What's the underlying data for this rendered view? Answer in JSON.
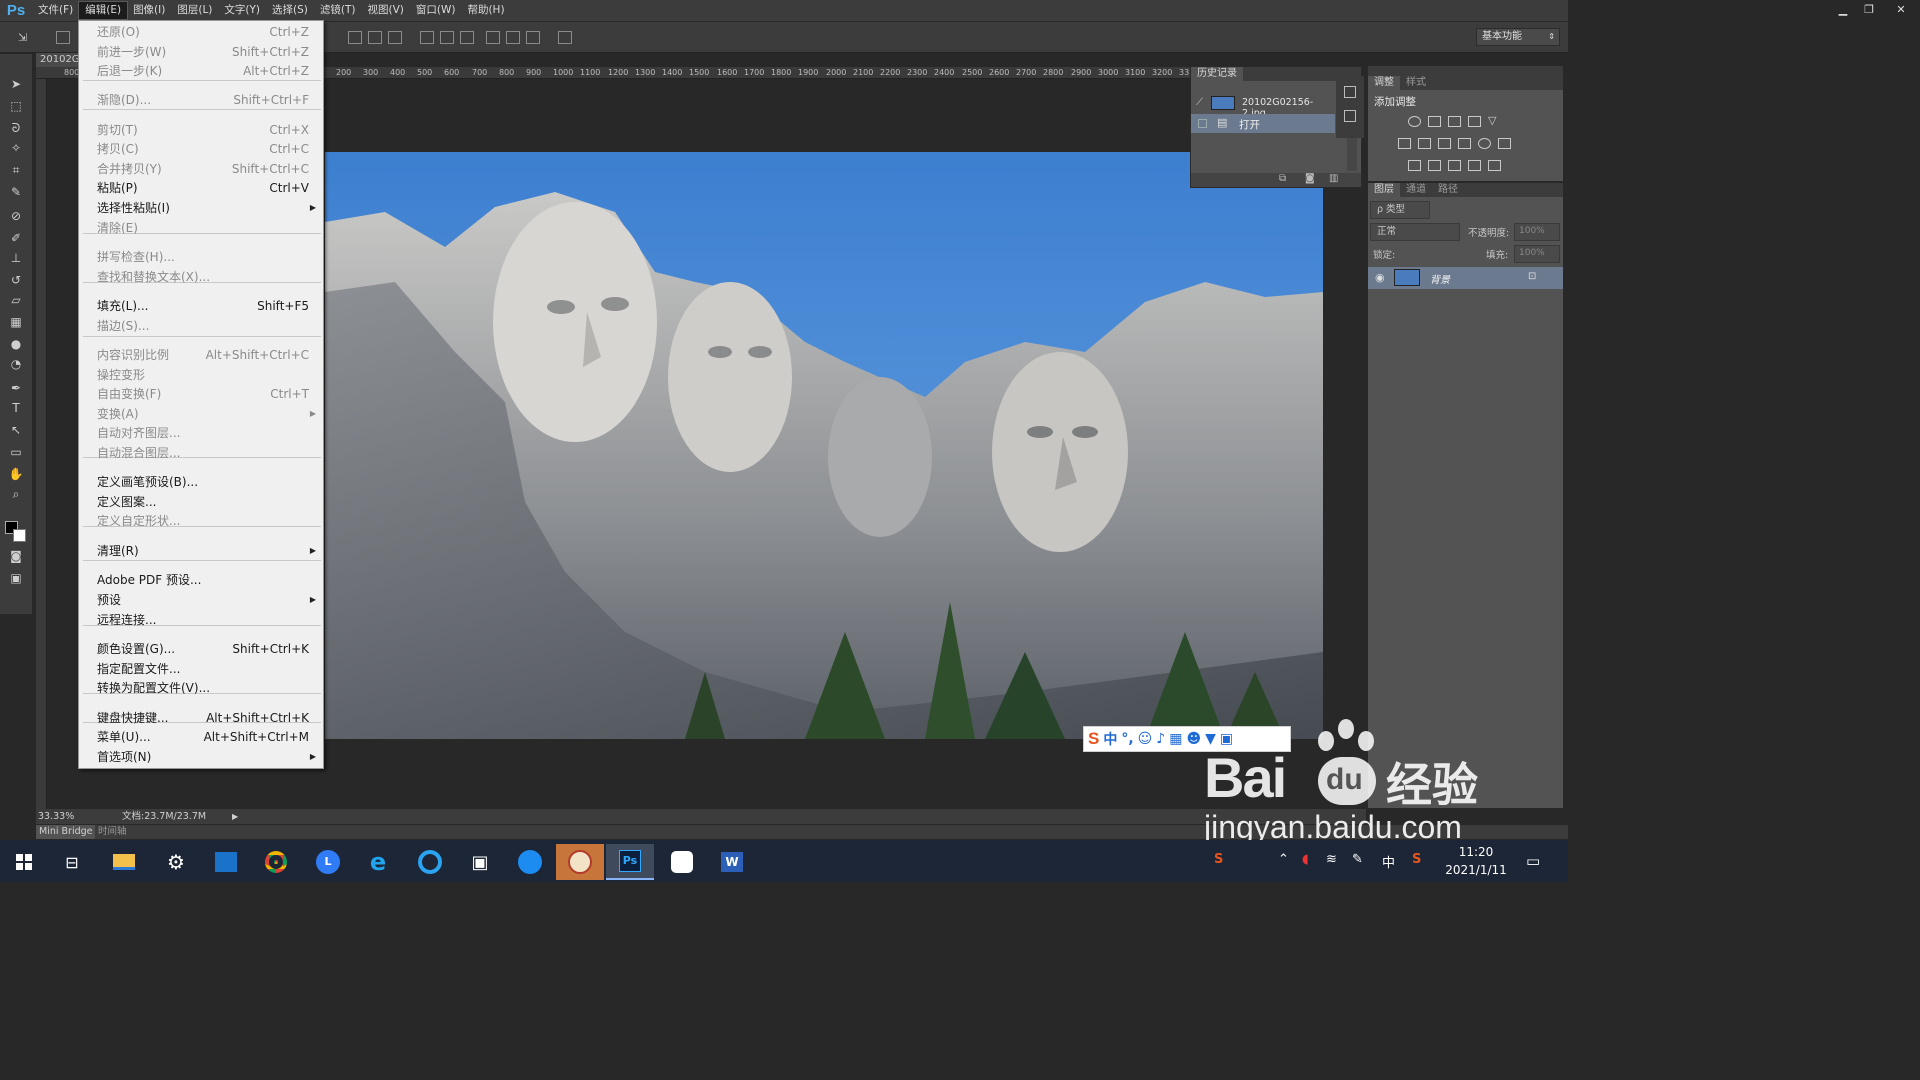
{
  "app": {
    "logo": "Ps"
  },
  "menubar": [
    "文件(F)",
    "编辑(E)",
    "图像(I)",
    "图层(L)",
    "文字(Y)",
    "选择(S)",
    "滤镜(T)",
    "视图(V)",
    "窗口(W)",
    "帮助(H)"
  ],
  "window_controls": {
    "minimize": "▁",
    "restore": "❐",
    "close": "✕"
  },
  "options": {
    "workspace": "基本功能"
  },
  "document": {
    "tab": "20102G",
    "ruler_top": [
      "800",
      "200",
      "300",
      "400",
      "500",
      "600",
      "700",
      "800",
      "900",
      "1000",
      "1100",
      "1200",
      "1300",
      "1400",
      "1500",
      "1600",
      "1700",
      "1800",
      "1900",
      "2000",
      "2100",
      "2200",
      "2300",
      "2400",
      "2500",
      "2600",
      "2700",
      "2800",
      "2900",
      "3000",
      "3100",
      "3200",
      "33"
    ]
  },
  "edit_menu": {
    "items": [
      {
        "label": "还原(O)",
        "shortcut": "Ctrl+Z",
        "disabled": true
      },
      {
        "label": "前进一步(W)",
        "shortcut": "Shift+Ctrl+Z",
        "disabled": true
      },
      {
        "label": "后退一步(K)",
        "shortcut": "Alt+Ctrl+Z",
        "disabled": true
      },
      {
        "label": "渐隐(D)...",
        "shortcut": "Shift+Ctrl+F",
        "disabled": true
      },
      {
        "label": "剪切(T)",
        "shortcut": "Ctrl+X",
        "disabled": true
      },
      {
        "label": "拷贝(C)",
        "shortcut": "Ctrl+C",
        "disabled": true
      },
      {
        "label": "合并拷贝(Y)",
        "shortcut": "Shift+Ctrl+C",
        "disabled": true
      },
      {
        "label": "粘贴(P)",
        "shortcut": "Ctrl+V",
        "disabled": false
      },
      {
        "label": "选择性粘贴(I)",
        "shortcut": "",
        "disabled": false
      },
      {
        "label": "清除(E)",
        "shortcut": "",
        "disabled": true
      },
      {
        "label": "拼写检查(H)...",
        "shortcut": "",
        "disabled": true
      },
      {
        "label": "查找和替换文本(X)...",
        "shortcut": "",
        "disabled": true
      },
      {
        "label": "填充(L)...",
        "shortcut": "Shift+F5",
        "disabled": false
      },
      {
        "label": "描边(S)...",
        "shortcut": "",
        "disabled": true
      },
      {
        "label": "内容识别比例",
        "shortcut": "Alt+Shift+Ctrl+C",
        "disabled": true
      },
      {
        "label": "操控变形",
        "shortcut": "",
        "disabled": true
      },
      {
        "label": "自由变换(F)",
        "shortcut": "Ctrl+T",
        "disabled": true
      },
      {
        "label": "变换(A)",
        "shortcut": "",
        "disabled": true
      },
      {
        "label": "自动对齐图层...",
        "shortcut": "",
        "disabled": true
      },
      {
        "label": "自动混合图层...",
        "shortcut": "",
        "disabled": true
      },
      {
        "label": "定义画笔预设(B)...",
        "shortcut": "",
        "disabled": false
      },
      {
        "label": "定义图案...",
        "shortcut": "",
        "disabled": false
      },
      {
        "label": "定义自定形状...",
        "shortcut": "",
        "disabled": true
      },
      {
        "label": "清理(R)",
        "shortcut": "",
        "disabled": false
      },
      {
        "label": "Adobe PDF 预设...",
        "shortcut": "",
        "disabled": false
      },
      {
        "label": "预设",
        "shortcut": "",
        "disabled": false
      },
      {
        "label": "远程连接...",
        "shortcut": "",
        "disabled": false
      },
      {
        "label": "颜色设置(G)...",
        "shortcut": "Shift+Ctrl+K",
        "disabled": false
      },
      {
        "label": "指定配置文件...",
        "shortcut": "",
        "disabled": false
      },
      {
        "label": "转换为配置文件(V)...",
        "shortcut": "",
        "disabled": false
      },
      {
        "label": "键盘快捷键...",
        "shortcut": "Alt+Shift+Ctrl+K",
        "disabled": false
      },
      {
        "label": "菜单(U)...",
        "shortcut": "Alt+Shift+Ctrl+M",
        "disabled": false
      },
      {
        "label": "首选项(N)",
        "shortcut": "",
        "disabled": false
      }
    ]
  },
  "history": {
    "tab": "历史记录",
    "snapshot": "20102G02156-2.jpg",
    "step": "打开"
  },
  "adjustments": {
    "tabs": [
      "调整",
      "样式"
    ],
    "title": "添加调整"
  },
  "layers": {
    "tabs": [
      "图层",
      "通道",
      "路径"
    ],
    "filter": "ρ 类型",
    "blend_mode": "正常",
    "opacity_label": "不透明度:",
    "opacity_value": "100%",
    "lock_label": "锁定:",
    "fill_label": "填充:",
    "fill_value": "100%",
    "layer_name": "背景"
  },
  "status": {
    "zoom": "33.33%",
    "doc": "文档:23.7M/23.7M"
  },
  "bottom_tabs": [
    "Mini Bridge",
    "时间轴"
  ],
  "ime": {
    "lang": "中",
    "punct": "°,"
  },
  "watermark": {
    "brand_a": "Bai",
    "brand_b": "du",
    "brand_c": "经验",
    "url": "jingyan.baidu.com"
  },
  "taskbar": {
    "time": "11:20",
    "date": "2021/1/11",
    "lang": "中"
  }
}
